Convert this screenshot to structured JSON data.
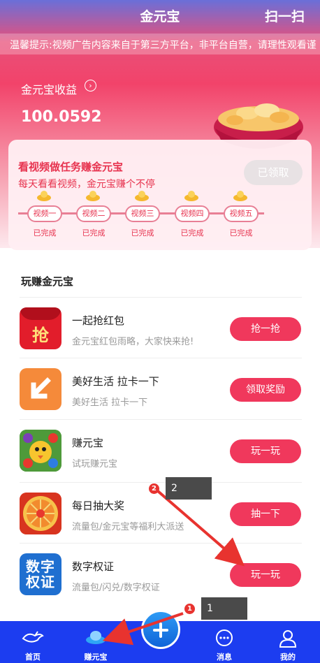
{
  "header": {
    "title": "金元宝",
    "scan_label": "扫一扫"
  },
  "notice": "温馨提示:视频广告内容来自于第三方平台，非平台自营，请理性观看谨",
  "earnings": {
    "label": "金元宝收益",
    "value": "100.0592"
  },
  "task_card": {
    "title": "看视频做任务赚金元宝",
    "subtitle": "每天看看视频，金元宝赚个不停",
    "claim_label": "已领取",
    "steps": [
      {
        "label": "视频一",
        "status": "已完成"
      },
      {
        "label": "视频二",
        "status": "已完成"
      },
      {
        "label": "视频三",
        "status": "已完成"
      },
      {
        "label": "视频四",
        "status": "已完成"
      },
      {
        "label": "视频五",
        "status": "已完成"
      }
    ]
  },
  "section_title": "玩赚金元宝",
  "list": [
    {
      "name": "一起抢红包",
      "desc": "金元宝红包雨略，大家快来抢!",
      "button": "抢一抢",
      "icon_text": "抢",
      "icon": "red-envelope-icon"
    },
    {
      "name": "美好生活 拉卡一下",
      "desc": "美好生活 拉卡一下",
      "button": "领取奖励",
      "icon_text": "",
      "icon": "arrow-down-left-icon"
    },
    {
      "name": "赚元宝",
      "desc": "试玩赚元宝",
      "button": "玩一玩",
      "icon_text": "",
      "icon": "game-icon"
    },
    {
      "name": "每日抽大奖",
      "desc": "流量包/金元宝等福利大派送",
      "button": "抽一下",
      "icon_text": "",
      "icon": "prize-wheel-icon"
    },
    {
      "name": "数字权证",
      "desc": "流量包/闪兑/数字权证",
      "button": "玩一玩",
      "icon_text": "数字权证",
      "icon": "digital-warrant-icon"
    }
  ],
  "nav": [
    {
      "label": "首页",
      "icon": "home-icon"
    },
    {
      "label": "赚元宝",
      "icon": "ingot-icon"
    },
    {
      "label": "消息",
      "icon": "message-icon"
    },
    {
      "label": "我的",
      "icon": "profile-icon"
    }
  ],
  "annotations": [
    {
      "badge": "1",
      "tag": "1"
    },
    {
      "badge": "2",
      "tag": "2"
    }
  ],
  "colors": {
    "accent": "#f0385c",
    "nav": "#1c3df0",
    "annotation": "#e8332f"
  }
}
